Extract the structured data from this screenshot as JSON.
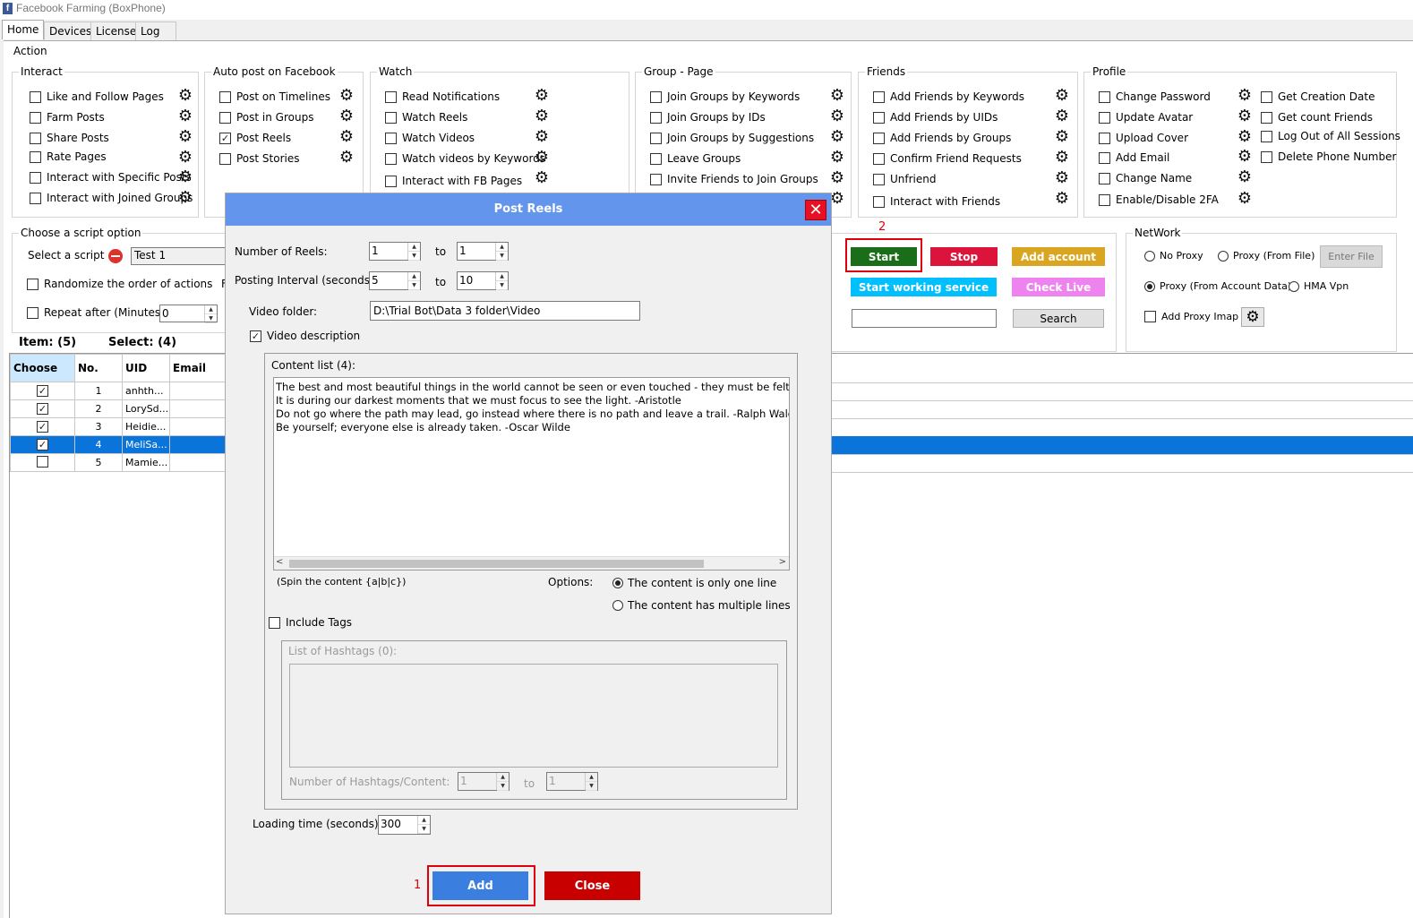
{
  "window": {
    "title": "Facebook Farming (BoxPhone)",
    "icon": "facebook-icon"
  },
  "tabs": [
    "Home",
    "Devices",
    "License",
    "Log"
  ],
  "action_label": "Action",
  "groups": {
    "interact": {
      "title": "Interact",
      "items": [
        {
          "label": "Like and Follow Pages",
          "checked": false
        },
        {
          "label": "Farm Posts",
          "checked": false
        },
        {
          "label": "Share Posts",
          "checked": false
        },
        {
          "label": "Rate Pages",
          "checked": false
        },
        {
          "label": "Interact with Specific Posts",
          "checked": false
        },
        {
          "label": "Interact with Joined Groups",
          "checked": false
        }
      ]
    },
    "autopost": {
      "title": "Auto post on Facebook",
      "items": [
        {
          "label": "Post on Timelines",
          "checked": false
        },
        {
          "label": "Post in Groups",
          "checked": false
        },
        {
          "label": "Post Reels",
          "checked": true
        },
        {
          "label": "Post Stories",
          "checked": false
        }
      ]
    },
    "watch": {
      "title": "Watch",
      "items": [
        {
          "label": "Read Notifications",
          "checked": false
        },
        {
          "label": "Watch Reels",
          "checked": false
        },
        {
          "label": "Watch Videos",
          "checked": false
        },
        {
          "label": "Watch videos by Keywords",
          "checked": false
        },
        {
          "label": "Interact with FB Pages",
          "checked": false
        }
      ]
    },
    "group_page": {
      "title": "Group - Page",
      "items": [
        {
          "label": "Join Groups by Keywords",
          "checked": false
        },
        {
          "label": "Join Groups by IDs",
          "checked": false
        },
        {
          "label": "Join Groups by Suggestions",
          "checked": false
        },
        {
          "label": "Leave Groups",
          "checked": false
        },
        {
          "label": "Invite Friends to Join Groups",
          "checked": false
        }
      ]
    },
    "friends": {
      "title": "Friends",
      "items": [
        {
          "label": "Add Friends by Keywords",
          "checked": false
        },
        {
          "label": "Add Friends by UIDs",
          "checked": false
        },
        {
          "label": "Add Friends by  Groups",
          "checked": false
        },
        {
          "label": "Confirm Friend Requests",
          "checked": false
        },
        {
          "label": "Unfriend",
          "checked": false
        },
        {
          "label": "Interact with Friends",
          "checked": false
        }
      ]
    },
    "profile": {
      "title": "Profile",
      "items": [
        {
          "label": "Change Password",
          "checked": false
        },
        {
          "label": "Update Avatar",
          "checked": false
        },
        {
          "label": "Upload Cover",
          "checked": false
        },
        {
          "label": "Add Email",
          "checked": false
        },
        {
          "label": "Change Name",
          "checked": false
        },
        {
          "label": "Enable/Disable 2FA",
          "checked": false
        }
      ],
      "items2": [
        {
          "label": "Get Creation Date",
          "checked": false
        },
        {
          "label": "Get count Friends",
          "checked": false
        },
        {
          "label": "Log Out of All Sessions",
          "checked": false
        },
        {
          "label": "Delete Phone Number",
          "checked": false
        }
      ]
    }
  },
  "script_option": {
    "title": "Choose a script option",
    "select_label": "Select a script",
    "script_value": "Test 1",
    "randomize_label": "Randomize the order of actions",
    "randomize_trailing": "F",
    "repeat_label": "Repeat after (Minutes)",
    "repeat_value": "0"
  },
  "counts": {
    "item": "Item: (5)",
    "select": "Select: (4)"
  },
  "table": {
    "headers": [
      "Choose",
      "No.",
      "UID",
      "Email"
    ],
    "rows": [
      {
        "checked": true,
        "no": "1",
        "uid": "anhth...",
        "selected": false
      },
      {
        "checked": true,
        "no": "2",
        "uid": "LorySd...",
        "selected": false
      },
      {
        "checked": true,
        "no": "3",
        "uid": "Heidie...",
        "selected": false
      },
      {
        "checked": true,
        "no": "4",
        "uid": "MeliSa...",
        "selected": true
      },
      {
        "checked": false,
        "no": "5",
        "uid": "Mamie...",
        "selected": false
      }
    ]
  },
  "controls": {
    "start": "Start",
    "stop": "Stop",
    "add_account": "Add account",
    "start_service": "Start working service",
    "check_live": "Check Live",
    "search": "Search",
    "search_value": "",
    "colors": {
      "start": "#1a6e1a",
      "stop": "#dc143c",
      "add_account": "#daa520",
      "start_service": "#00bfff",
      "check_live": "#ee82ee"
    }
  },
  "network": {
    "title": "NetWork",
    "no_proxy": "No Proxy",
    "proxy_file": "Proxy (From File)",
    "enter_file": "Enter File",
    "proxy_account": "Proxy (From Account Data)",
    "hma": "HMA Vpn",
    "add_proxy_imap": "Add Proxy Imap",
    "selected": "proxy_account"
  },
  "modal": {
    "title": "Post Reels",
    "reels_label": "Number of Reels:",
    "reels_from": "1",
    "reels_to": "1",
    "interval_label": "Posting Interval (seconds):",
    "interval_from": "5",
    "interval_to": "10",
    "to": "to",
    "video_folder_label": "Video folder:",
    "video_folder_value": "D:\\Trial Bot\\Data 3 folder\\Video",
    "video_desc_label": "Video description",
    "video_desc_checked": true,
    "content_list_label": "Content list (4):",
    "content_lines": [
      "The best and most beautiful things in the world cannot be seen or even touched - they must be felt with the h",
      "It is during our darkest moments that we must focus to see the light. -Aristotle",
      "Do not go where the path may lead, go instead where there is no path and leave a trail. -Ralph Waldo Emerson",
      "Be yourself; everyone else is already taken. -Oscar Wilde"
    ],
    "spin_hint": "(Spin the content {a|b|c})",
    "options_label": "Options:",
    "opt_one_line": "The content is only one line",
    "opt_multi_line": "The content has multiple lines",
    "include_tags_label": "Include Tags",
    "hashtags_label": "List of Hashtags (0):",
    "hashtags_per_label": "Number of Hashtags/Content:",
    "hashtags_from": "1",
    "hashtags_to": "1",
    "loading_label": "Loading time (seconds):",
    "loading_value": "300",
    "add": "Add",
    "close": "Close",
    "add_color": "#3a7ee0",
    "close_color": "#c80000"
  },
  "annotations": {
    "one": "1",
    "two": "2"
  }
}
